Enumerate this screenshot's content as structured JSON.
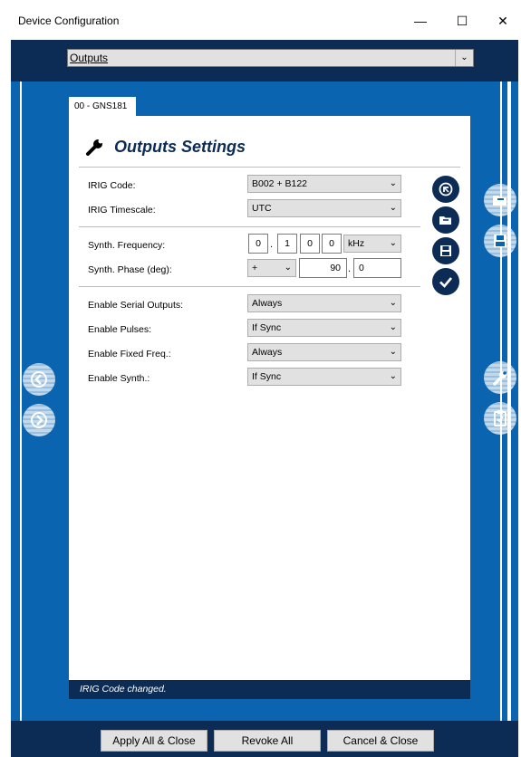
{
  "window": {
    "title": "Device Configuration",
    "minimize": "—",
    "maximize": "☐",
    "close": "✕"
  },
  "page_selector": {
    "value": "Outputs"
  },
  "tab": {
    "label": "00 - GNS181"
  },
  "panel": {
    "heading": "Outputs Settings",
    "irig_code": {
      "label": "IRIG Code:",
      "value": "B002 + B122"
    },
    "irig_timescale": {
      "label": "IRIG Timescale:",
      "value": "UTC"
    },
    "synth_frequency": {
      "label": "Synth. Frequency:",
      "digits": [
        "0",
        "1",
        "0",
        "0"
      ],
      "unit": "kHz"
    },
    "synth_phase": {
      "label": "Synth. Phase (deg):",
      "sign": "+",
      "integer": "90",
      "fraction": "0"
    },
    "serial_outputs": {
      "label": "Enable Serial Outputs:",
      "value": "Always"
    },
    "pulses": {
      "label": "Enable Pulses:",
      "value": "If Sync"
    },
    "fixed_freq": {
      "label": "Enable Fixed Freq.:",
      "value": "Always"
    },
    "synth": {
      "label": "Enable Synth.:",
      "value": "If Sync"
    },
    "decimal_separator": "."
  },
  "status": {
    "message": "IRIG Code changed."
  },
  "footer": {
    "apply_all_close": "Apply All & Close",
    "revoke_all": "Revoke All",
    "cancel_close": "Cancel & Close"
  },
  "colors": {
    "dark_navy": "#0c2c55",
    "blue": "#0a64b0",
    "button_gray": "#e1e1e1"
  }
}
